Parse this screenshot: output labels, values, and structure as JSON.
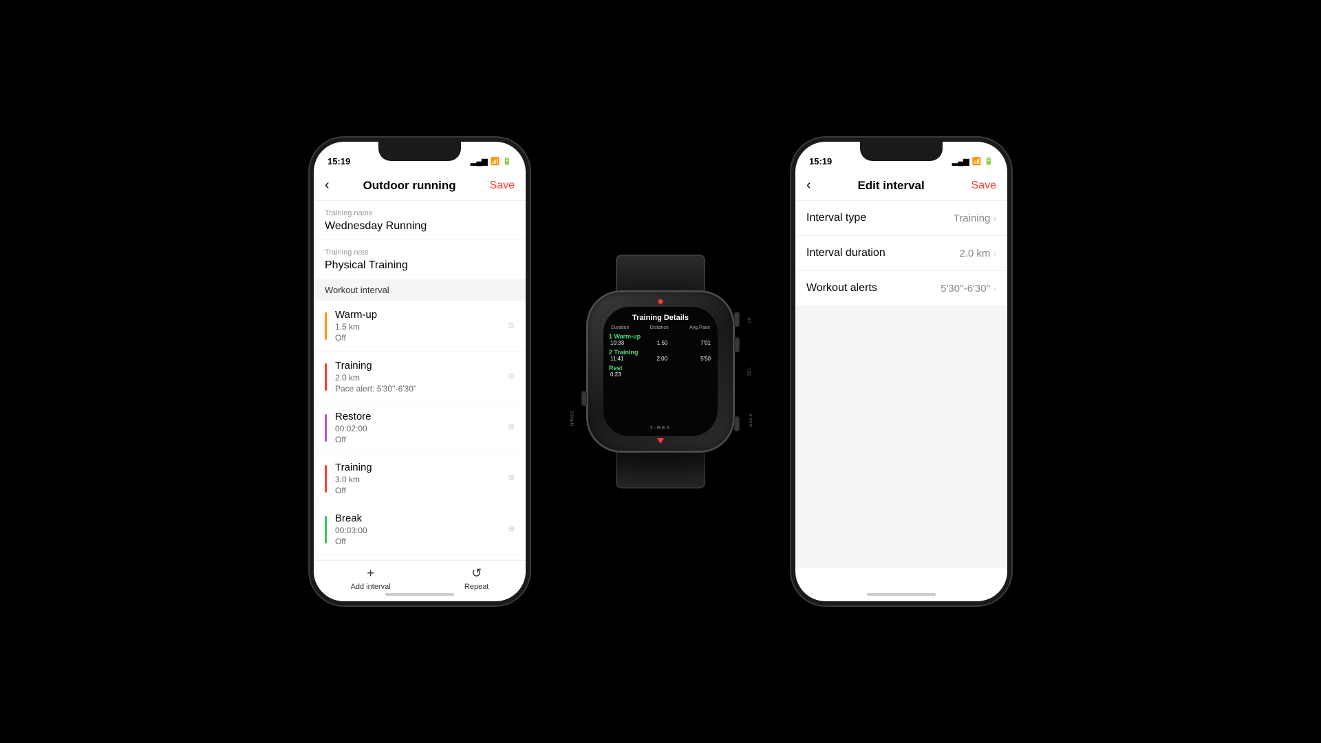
{
  "phone_left": {
    "status_time": "15:19",
    "nav_title": "Outdoor running",
    "nav_save": "Save",
    "training_name_label": "Training name",
    "training_name_value": "Wednesday Running",
    "training_note_label": "Training note",
    "training_note_value": "Physical Training",
    "workout_interval_header": "Workout interval",
    "intervals": [
      {
        "name": "Warm-up",
        "detail1": "1.5 km",
        "detail2": "Off",
        "color": "#ff9500"
      },
      {
        "name": "Training",
        "detail1": "2.0 km",
        "detail2": "Pace alert: 5'30''-6'30''",
        "color": "#ff3b30"
      },
      {
        "name": "Restore",
        "detail1": "00:02:00",
        "detail2": "Off",
        "color": "#af52de"
      },
      {
        "name": "Training",
        "detail1": "3.0 km",
        "detail2": "Off",
        "color": "#ff3b30"
      },
      {
        "name": "Break",
        "detail1": "00:03:00",
        "detail2": "Off",
        "color": "#34c759"
      }
    ],
    "add_interval": "Add interval",
    "repeat": "Repeat"
  },
  "phone_right": {
    "status_time": "15:19",
    "nav_title": "Edit interval",
    "nav_save": "Save",
    "rows": [
      {
        "label": "Interval type",
        "value": "Training"
      },
      {
        "label": "Interval duration",
        "value": "2.0 km"
      },
      {
        "label": "Workout alerts",
        "value": "5'30''-6'30''"
      }
    ]
  },
  "watch": {
    "title": "Training Details",
    "header": {
      "col1": "Duration",
      "col2": "Distance",
      "col3": "Avg.Pace"
    },
    "items": [
      {
        "name": "1 Warm-up",
        "col1": "10:33",
        "col2": "1.50",
        "col3": "7'01"
      },
      {
        "name": "2 Training",
        "col1": "11:41",
        "col2": "2.00",
        "col3": "5'50"
      }
    ],
    "rest_label": "Rest",
    "rest_value": "0:23",
    "label": "T-REX",
    "labels": {
      "up": "UP",
      "sel": "SEL",
      "down": "DOWN",
      "back": "BACK"
    }
  }
}
